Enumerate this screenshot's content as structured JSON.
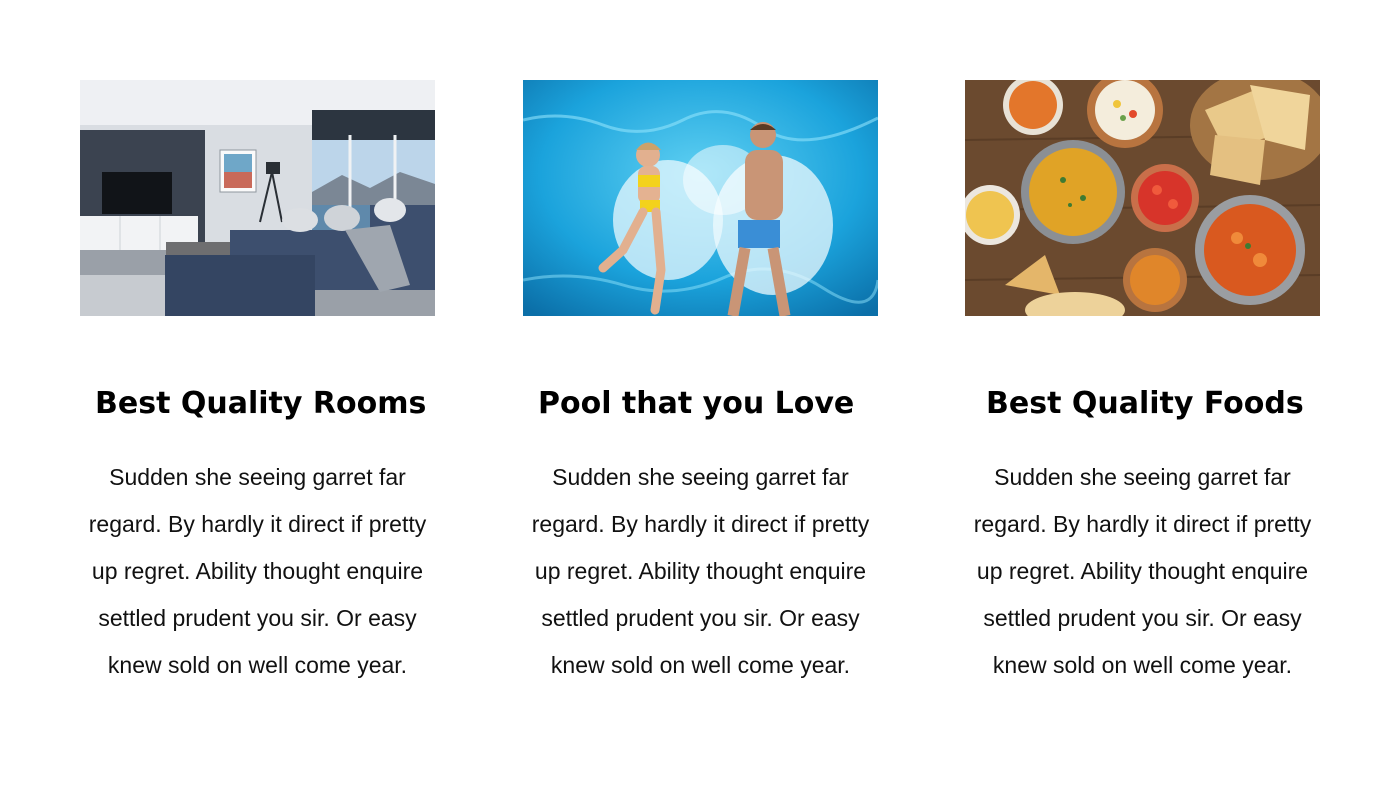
{
  "features": [
    {
      "image_alt": "living-room-photo",
      "title": "Best Quality Rooms",
      "description": "Sudden she seeing garret far regard. By hardly it direct if pretty up regret. Ability thought enquire settled prudent you sir. Or easy knew sold on well come year."
    },
    {
      "image_alt": "swimming-pool-photo",
      "title": "Pool that you Love",
      "description": "Sudden she seeing garret far regard. By hardly it direct if pretty up regret. Ability thought enquire settled prudent you sir. Or easy knew sold on well come year."
    },
    {
      "image_alt": "indian-food-photo",
      "title": "Best Quality Foods",
      "description": "Sudden she seeing garret far regard. By hardly it direct if pretty up regret. Ability thought enquire settled prudent you sir. Or easy knew sold on well come year."
    }
  ],
  "colors": {
    "title": "#000000",
    "text": "#111111",
    "background": "#ffffff"
  }
}
